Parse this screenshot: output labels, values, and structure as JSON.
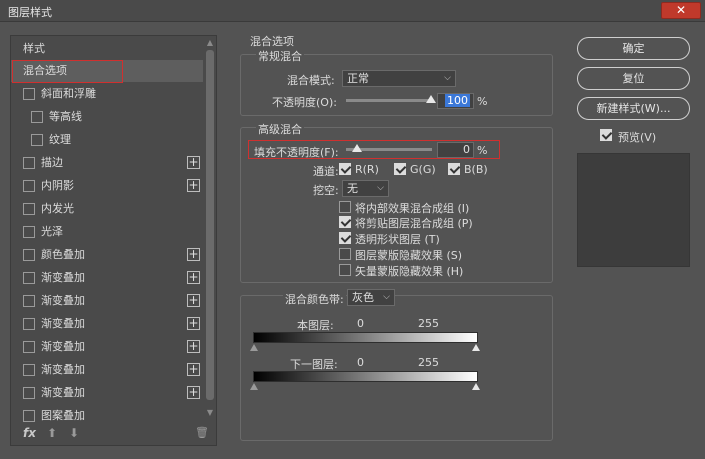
{
  "window": {
    "title": "图层样式",
    "close_glyph": "✕"
  },
  "left_panel": {
    "header": "样式",
    "items": [
      {
        "label": "混合选项",
        "checkbox": false,
        "plus": false,
        "indent": 0,
        "selected": true
      },
      {
        "label": "斜面和浮雕",
        "checkbox": true,
        "plus": false,
        "indent": 0
      },
      {
        "label": "等高线",
        "checkbox": true,
        "plus": false,
        "indent": 1
      },
      {
        "label": "纹理",
        "checkbox": true,
        "plus": false,
        "indent": 1
      },
      {
        "label": "描边",
        "checkbox": true,
        "plus": true,
        "indent": 0
      },
      {
        "label": "内阴影",
        "checkbox": true,
        "plus": true,
        "indent": 0
      },
      {
        "label": "内发光",
        "checkbox": true,
        "plus": false,
        "indent": 0
      },
      {
        "label": "光泽",
        "checkbox": true,
        "plus": false,
        "indent": 0
      },
      {
        "label": "颜色叠加",
        "checkbox": true,
        "plus": true,
        "indent": 0
      },
      {
        "label": "渐变叠加",
        "checkbox": true,
        "plus": true,
        "indent": 0
      },
      {
        "label": "渐变叠加",
        "checkbox": true,
        "plus": true,
        "indent": 0
      },
      {
        "label": "渐变叠加",
        "checkbox": true,
        "plus": true,
        "indent": 0
      },
      {
        "label": "渐变叠加",
        "checkbox": true,
        "plus": true,
        "indent": 0
      },
      {
        "label": "渐变叠加",
        "checkbox": true,
        "plus": true,
        "indent": 0
      },
      {
        "label": "渐变叠加",
        "checkbox": true,
        "plus": true,
        "indent": 0
      },
      {
        "label": "图案叠加",
        "checkbox": true,
        "plus": false,
        "indent": 0
      }
    ],
    "footer": {
      "fx": "fx",
      "up": "⬆",
      "down": "⬇",
      "trash": "🗑"
    }
  },
  "blending": {
    "section_title": "混合选项",
    "general_title": "常规混合",
    "blend_mode_label": "混合模式:",
    "blend_mode_value": "正常",
    "opacity_label": "不透明度(O):",
    "opacity_value": "100",
    "opacity_unit": "%",
    "opacity_level": 1.0,
    "advanced_title": "高级混合",
    "fill_opacity_label": "填充不透明度(F):",
    "fill_opacity_value": "0",
    "fill_opacity_unit": "%",
    "fill_opacity_level": 0.0,
    "channels_label": "通道:",
    "channel_r": "R(R)",
    "channel_g": "G(G)",
    "channel_b": "B(B)",
    "knockout_label": "挖空:",
    "knockout_value": "无",
    "options": [
      {
        "label": "将内部效果混合成组 (I)",
        "checked": false
      },
      {
        "label": "将剪贴图层混合成组 (P)",
        "checked": true
      },
      {
        "label": "透明形状图层 (T)",
        "checked": true
      },
      {
        "label": "图层蒙版隐藏效果 (S)",
        "checked": false
      },
      {
        "label": "矢量蒙版隐藏效果 (H)",
        "checked": false
      }
    ],
    "blend_if_label": "混合颜色带:",
    "blend_if_value": "灰色",
    "this_layer_label": "本图层:",
    "this_layer_min": "0",
    "this_layer_max": "255",
    "under_layer_label": "下一图层:",
    "under_layer_min": "0",
    "under_layer_max": "255"
  },
  "buttons": {
    "ok": "确定",
    "reset": "复位",
    "new_style": "新建样式(W)...",
    "preview_label": "预览(V)",
    "preview_checked": true
  },
  "colors": {
    "highlight_red": "#d0302f",
    "selection_blue": "#3b78d8",
    "background": "#535353"
  }
}
